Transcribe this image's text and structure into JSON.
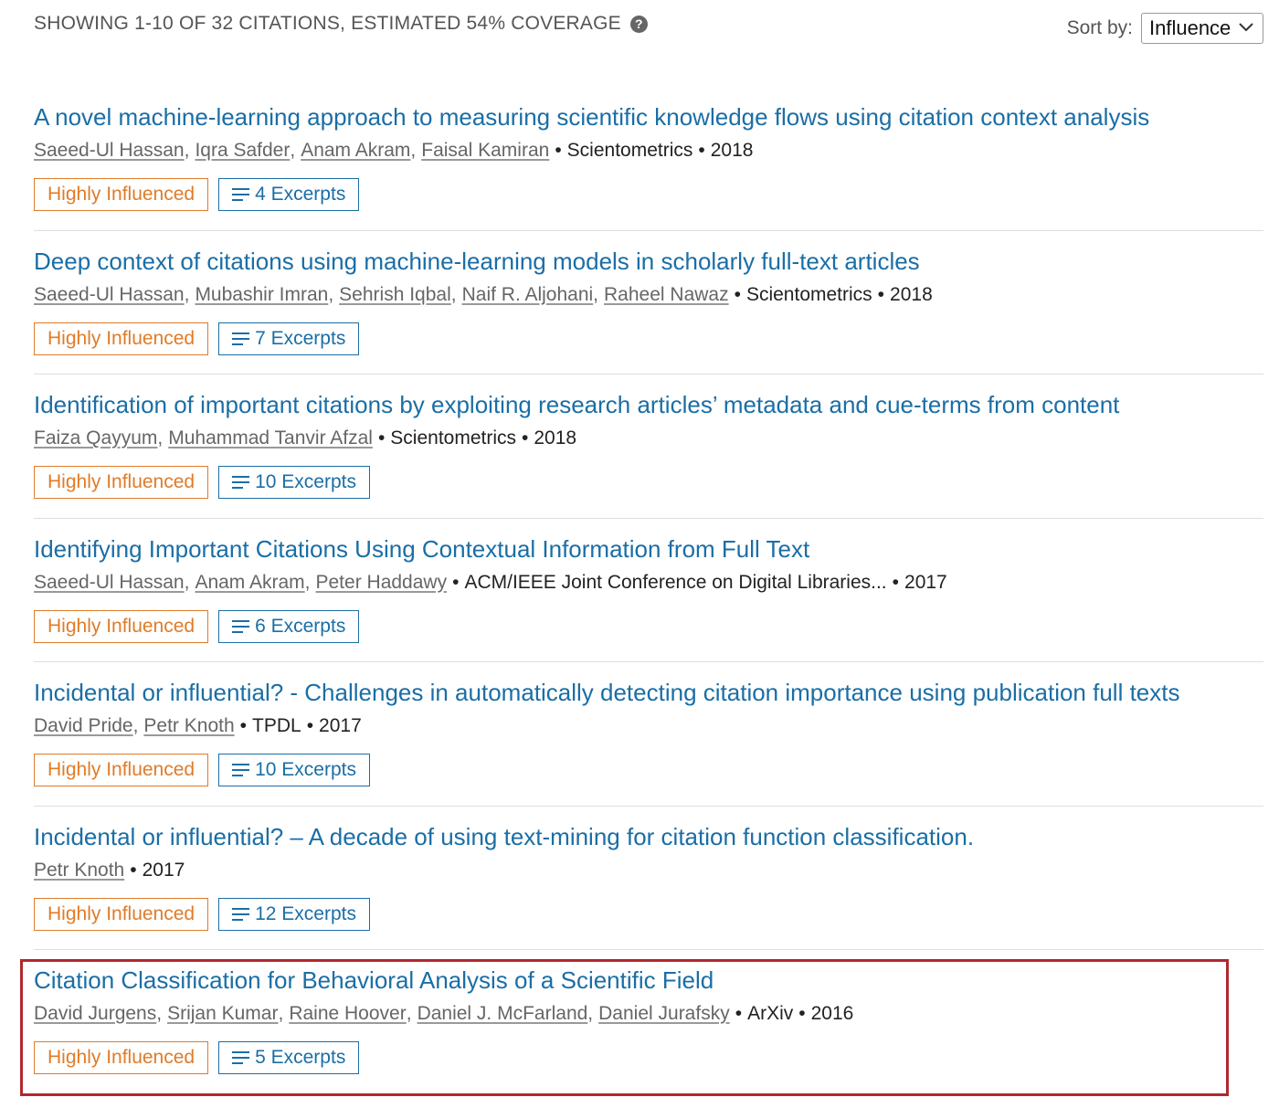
{
  "header": {
    "showing_text": "SHOWING 1-10 OF 32 CITATIONS, ESTIMATED 54% COVERAGE",
    "help_icon": "question-circle-icon",
    "sort_label": "Sort by:",
    "sort_value": "Influence"
  },
  "colors": {
    "link": "#1a6ea6",
    "badge_orange": "#e07b28",
    "highlight": "#b0292f"
  },
  "citations": [
    {
      "title": "A novel machine-learning approach to measuring scientific knowledge flows using citation context analysis",
      "authors": [
        "Saeed-Ul Hassan",
        "Iqra Safder",
        "Anam Akram",
        "Faisal Kamiran"
      ],
      "venue": "Scientometrics",
      "year": "2018",
      "badge": "Highly Influenced",
      "excerpts": "4 Excerpts"
    },
    {
      "title": "Deep context of citations using machine-learning models in scholarly full-text articles",
      "authors": [
        "Saeed-Ul Hassan",
        "Mubashir Imran",
        "Sehrish Iqbal",
        "Naif R. Aljohani",
        "Raheel Nawaz"
      ],
      "venue": "Scientometrics",
      "year": "2018",
      "badge": "Highly Influenced",
      "excerpts": "7 Excerpts"
    },
    {
      "title": "Identification of important citations by exploiting research articles’ metadata and cue-terms from content",
      "authors": [
        "Faiza Qayyum",
        "Muhammad Tanvir Afzal"
      ],
      "venue": "Scientometrics",
      "year": "2018",
      "badge": "Highly Influenced",
      "excerpts": "10 Excerpts"
    },
    {
      "title": "Identifying Important Citations Using Contextual Information from Full Text",
      "authors": [
        "Saeed-Ul Hassan",
        "Anam Akram",
        "Peter Haddawy"
      ],
      "venue": "ACM/IEEE Joint Conference on Digital Libraries...",
      "year": "2017",
      "badge": "Highly Influenced",
      "excerpts": "6 Excerpts"
    },
    {
      "title": "Incidental or influential? - Challenges in automatically detecting citation importance using publication full texts",
      "authors": [
        "David Pride",
        "Petr Knoth"
      ],
      "venue": "TPDL",
      "year": "2017",
      "badge": "Highly Influenced",
      "excerpts": "10 Excerpts"
    },
    {
      "title": "Incidental or influential? – A decade of using text-mining for citation function classification.",
      "authors": [
        "Petr Knoth"
      ],
      "venue": "",
      "year": "2017",
      "badge": "Highly Influenced",
      "excerpts": "12 Excerpts"
    },
    {
      "title": "Citation Classification for Behavioral Analysis of a Scientific Field",
      "authors": [
        "David Jurgens",
        "Srijan Kumar",
        "Raine Hoover",
        "Daniel J. McFarland",
        "Daniel Jurafsky"
      ],
      "venue": "ArXiv",
      "year": "2016",
      "badge": "Highly Influenced",
      "excerpts": "5 Excerpts"
    }
  ]
}
